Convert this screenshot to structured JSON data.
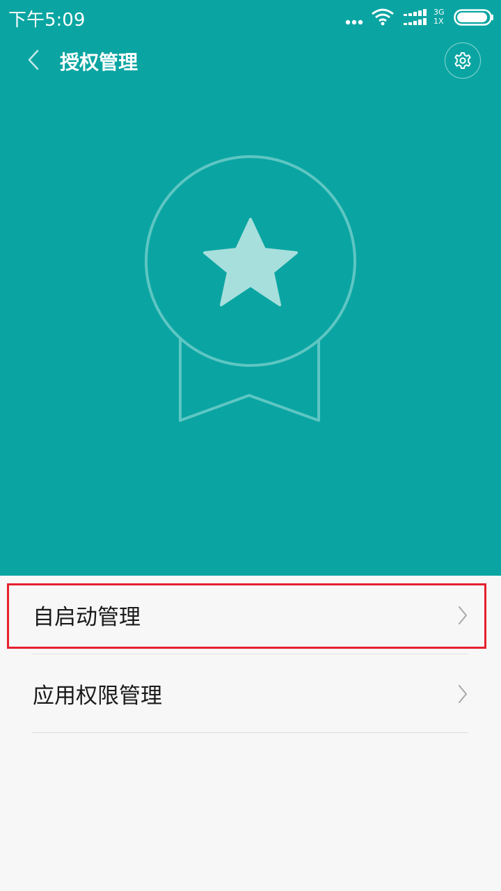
{
  "status_bar": {
    "time": "下午5:09",
    "network_top": "3G",
    "network_bottom": "1X",
    "icons": [
      "more-dots-icon",
      "wifi-icon",
      "signal-icon",
      "battery-icon"
    ]
  },
  "header": {
    "title": "授权管理",
    "back_icon": "chevron-left-icon",
    "settings_icon": "gear-icon"
  },
  "hero": {
    "icon": "medal-star-icon",
    "background_color": "#0aa5a2"
  },
  "list": {
    "items": [
      {
        "label": "自启动管理",
        "icon": "chevron-right-icon",
        "highlighted": true
      },
      {
        "label": "应用权限管理",
        "icon": "chevron-right-icon",
        "highlighted": false
      }
    ]
  },
  "colors": {
    "accent": "#0aa5a2",
    "highlight_border": "#e5202e",
    "list_background": "#f7f7f7"
  }
}
